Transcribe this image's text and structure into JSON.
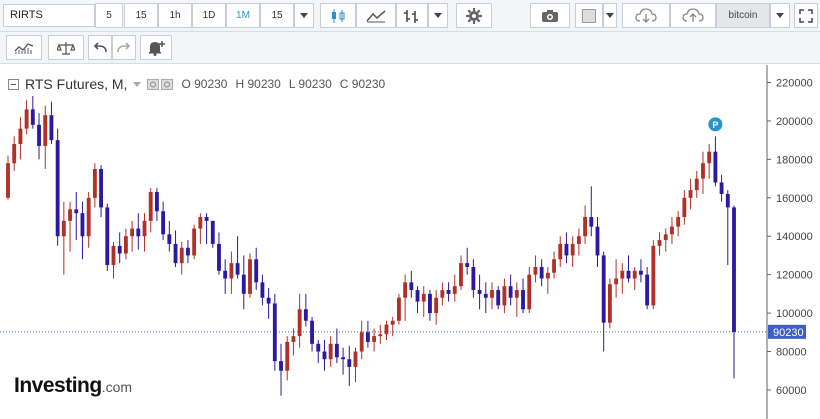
{
  "toolbar": {
    "symbol": "RIRTS",
    "intervals": [
      "5",
      "15",
      "1h",
      "1D",
      "1M",
      "15"
    ],
    "selected_interval": "1M",
    "search_text": "bitcoin"
  },
  "legend": {
    "title": "RTS Futures, M,",
    "open": "O 90230",
    "high": "H 90230",
    "low": "L 90230",
    "close": "C 90230"
  },
  "price_label": "90230",
  "logo": {
    "main": "Investing",
    "suffix": ".com"
  },
  "colors": {
    "up": "#b03128",
    "down": "#2b1aa0",
    "accent": "#2a93c9",
    "price_line": "#3d5ec9"
  },
  "chart_data": {
    "type": "candlestick",
    "yticks": [
      60000,
      80000,
      100000,
      120000,
      140000,
      160000,
      180000,
      200000,
      220000
    ],
    "ylim": [
      48000,
      226000
    ],
    "last_price": 90230,
    "marker": "P",
    "ohlc": [
      [
        160000,
        182000,
        159000,
        178000
      ],
      [
        178000,
        192000,
        174000,
        188000
      ],
      [
        188000,
        202000,
        180000,
        196000
      ],
      [
        196000,
        211000,
        193000,
        206000
      ],
      [
        206000,
        213000,
        196000,
        198000
      ],
      [
        198000,
        204000,
        180000,
        187000
      ],
      [
        187000,
        208000,
        175000,
        203000
      ],
      [
        203000,
        210000,
        188000,
        190000
      ],
      [
        190000,
        196000,
        135000,
        140000
      ],
      [
        140000,
        158000,
        120000,
        148000
      ],
      [
        148000,
        158000,
        132000,
        154000
      ],
      [
        154000,
        163000,
        138000,
        152000
      ],
      [
        152000,
        158000,
        128000,
        140000
      ],
      [
        140000,
        163000,
        134000,
        160000
      ],
      [
        160000,
        178000,
        155000,
        175000
      ],
      [
        175000,
        177000,
        150000,
        155000
      ],
      [
        155000,
        157000,
        122000,
        125000
      ],
      [
        125000,
        137000,
        118000,
        135000
      ],
      [
        135000,
        142000,
        126000,
        131000
      ],
      [
        131000,
        144000,
        128000,
        140000
      ],
      [
        140000,
        148000,
        132000,
        144000
      ],
      [
        144000,
        152000,
        133000,
        140000
      ],
      [
        140000,
        152000,
        132000,
        148000
      ],
      [
        148000,
        165000,
        142000,
        163000
      ],
      [
        163000,
        165000,
        148000,
        153000
      ],
      [
        153000,
        158000,
        138000,
        141000
      ],
      [
        141000,
        148000,
        132000,
        136000
      ],
      [
        136000,
        143000,
        124000,
        126000
      ],
      [
        126000,
        137000,
        120000,
        134000
      ],
      [
        134000,
        138000,
        126000,
        130000
      ],
      [
        130000,
        146000,
        128000,
        144000
      ],
      [
        144000,
        152000,
        136000,
        150000
      ],
      [
        150000,
        152000,
        136000,
        148000
      ],
      [
        148000,
        148000,
        134000,
        136000
      ],
      [
        136000,
        142000,
        120000,
        122000
      ],
      [
        122000,
        128000,
        110000,
        118000
      ],
      [
        118000,
        132000,
        110000,
        126000
      ],
      [
        126000,
        140000,
        118000,
        120000
      ],
      [
        120000,
        130000,
        102000,
        110000
      ],
      [
        110000,
        131000,
        108000,
        128000
      ],
      [
        128000,
        134000,
        112000,
        116000
      ],
      [
        116000,
        120000,
        104000,
        108000
      ],
      [
        108000,
        113000,
        97000,
        105000
      ],
      [
        105000,
        110000,
        70000,
        75000
      ],
      [
        75000,
        84000,
        57000,
        70000
      ],
      [
        70000,
        88000,
        65000,
        85000
      ],
      [
        85000,
        92000,
        78000,
        88000
      ],
      [
        88000,
        110000,
        82000,
        102000
      ],
      [
        102000,
        110000,
        93000,
        96000
      ],
      [
        96000,
        98000,
        80000,
        84000
      ],
      [
        84000,
        86000,
        74000,
        80000
      ],
      [
        80000,
        86000,
        70000,
        76000
      ],
      [
        76000,
        88000,
        72000,
        84000
      ],
      [
        84000,
        92000,
        74000,
        77000
      ],
      [
        77000,
        82000,
        68000,
        76000
      ],
      [
        76000,
        83000,
        62000,
        72000
      ],
      [
        72000,
        82000,
        64000,
        80000
      ],
      [
        80000,
        96000,
        76000,
        90000
      ],
      [
        90000,
        96000,
        82000,
        85000
      ],
      [
        85000,
        92000,
        80000,
        88000
      ],
      [
        88000,
        94000,
        84000,
        89000
      ],
      [
        89000,
        96000,
        86000,
        94000
      ],
      [
        94000,
        98000,
        88000,
        96000
      ],
      [
        96000,
        110000,
        94000,
        108000
      ],
      [
        108000,
        120000,
        96000,
        116000
      ],
      [
        116000,
        122000,
        108000,
        112000
      ],
      [
        112000,
        114000,
        100000,
        106000
      ],
      [
        106000,
        114000,
        98000,
        110000
      ],
      [
        110000,
        112000,
        96000,
        100000
      ],
      [
        100000,
        112000,
        94000,
        108000
      ],
      [
        108000,
        116000,
        104000,
        112000
      ],
      [
        112000,
        116000,
        106000,
        110000
      ],
      [
        110000,
        120000,
        106000,
        114000
      ],
      [
        114000,
        130000,
        112000,
        126000
      ],
      [
        126000,
        134000,
        120000,
        124000
      ],
      [
        124000,
        128000,
        108000,
        112000
      ],
      [
        112000,
        120000,
        102000,
        110000
      ],
      [
        110000,
        116000,
        100000,
        108000
      ],
      [
        108000,
        116000,
        102000,
        112000
      ],
      [
        112000,
        114000,
        102000,
        104000
      ],
      [
        104000,
        118000,
        100000,
        114000
      ],
      [
        114000,
        120000,
        104000,
        108000
      ],
      [
        108000,
        116000,
        98000,
        112000
      ],
      [
        112000,
        118000,
        100000,
        102000
      ],
      [
        102000,
        124000,
        100000,
        120000
      ],
      [
        120000,
        130000,
        116000,
        124000
      ],
      [
        124000,
        128000,
        114000,
        118000
      ],
      [
        118000,
        124000,
        110000,
        121000
      ],
      [
        121000,
        132000,
        118000,
        128000
      ],
      [
        128000,
        140000,
        124000,
        136000
      ],
      [
        136000,
        142000,
        126000,
        130000
      ],
      [
        130000,
        140000,
        124000,
        136000
      ],
      [
        136000,
        144000,
        130000,
        140000
      ],
      [
        140000,
        156000,
        136000,
        150000
      ],
      [
        150000,
        166000,
        140000,
        145000
      ],
      [
        145000,
        150000,
        124000,
        130000
      ],
      [
        130000,
        132000,
        80000,
        95000
      ],
      [
        95000,
        118000,
        92000,
        115000
      ],
      [
        115000,
        128000,
        108000,
        118000
      ],
      [
        118000,
        126000,
        110000,
        122000
      ],
      [
        122000,
        130000,
        116000,
        118000
      ],
      [
        118000,
        124000,
        112000,
        122000
      ],
      [
        122000,
        128000,
        116000,
        120000
      ],
      [
        120000,
        124000,
        102000,
        104000
      ],
      [
        104000,
        138000,
        102000,
        135000
      ],
      [
        135000,
        142000,
        130000,
        138000
      ],
      [
        138000,
        144000,
        132000,
        141000
      ],
      [
        141000,
        150000,
        136000,
        145000
      ],
      [
        145000,
        153000,
        140000,
        150000
      ],
      [
        150000,
        164000,
        146000,
        160000
      ],
      [
        160000,
        170000,
        154000,
        164000
      ],
      [
        164000,
        174000,
        160000,
        170000
      ],
      [
        170000,
        184000,
        162000,
        178000
      ],
      [
        178000,
        188000,
        170000,
        184000
      ],
      [
        184000,
        192000,
        166000,
        168000
      ],
      [
        168000,
        172000,
        158000,
        162000
      ],
      [
        162000,
        164000,
        125000,
        155000
      ],
      [
        155000,
        156000,
        66000,
        90230
      ]
    ]
  }
}
